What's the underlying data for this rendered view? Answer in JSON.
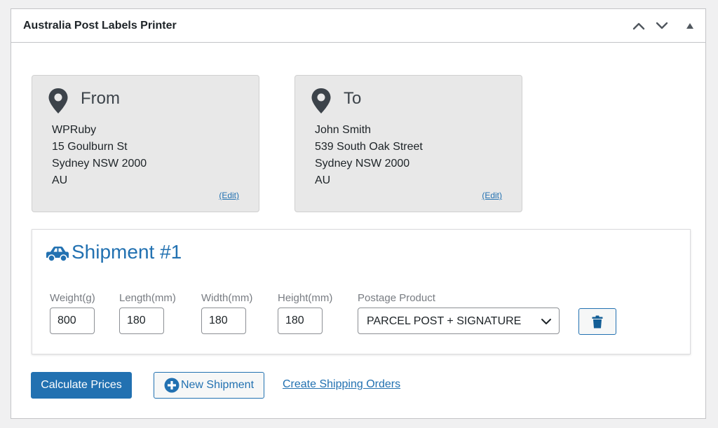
{
  "panel": {
    "title": "Australia Post Labels Printer"
  },
  "from": {
    "heading": "From",
    "lines": [
      "WPRuby",
      "15 Goulburn St",
      "Sydney NSW 2000",
      "AU"
    ],
    "edit_label": "(Edit)"
  },
  "to": {
    "heading": "To",
    "lines": [
      "John Smith",
      "539 South Oak Street",
      "Sydney NSW 2000",
      "AU"
    ],
    "edit_label": "(Edit)"
  },
  "shipment": {
    "title": "Shipment #1",
    "fields": {
      "weight": {
        "label": "Weight(g)",
        "value": "800"
      },
      "length": {
        "label": "Length(mm)",
        "value": "180"
      },
      "width": {
        "label": "Width(mm)",
        "value": "180"
      },
      "height": {
        "label": "Height(mm)",
        "value": "180"
      }
    },
    "postage": {
      "label": "Postage Product",
      "selected": "PARCEL POST + SIGNATURE"
    }
  },
  "actions": {
    "calculate_label": "Calculate Prices",
    "new_shipment_label": "New Shipment",
    "create_orders_label": "Create Shipping Orders"
  },
  "icons": {
    "header": [
      "chevron-up-icon",
      "chevron-down-icon",
      "triangle-up-icon"
    ],
    "address": "map-pin-icon",
    "shipment": "car-icon",
    "delete": "trash-icon",
    "add": "plus-circle-icon"
  },
  "colors": {
    "accent": "#2271b1",
    "card_bg": "#e8e8e8",
    "page_bg": "#f0f0f1"
  }
}
